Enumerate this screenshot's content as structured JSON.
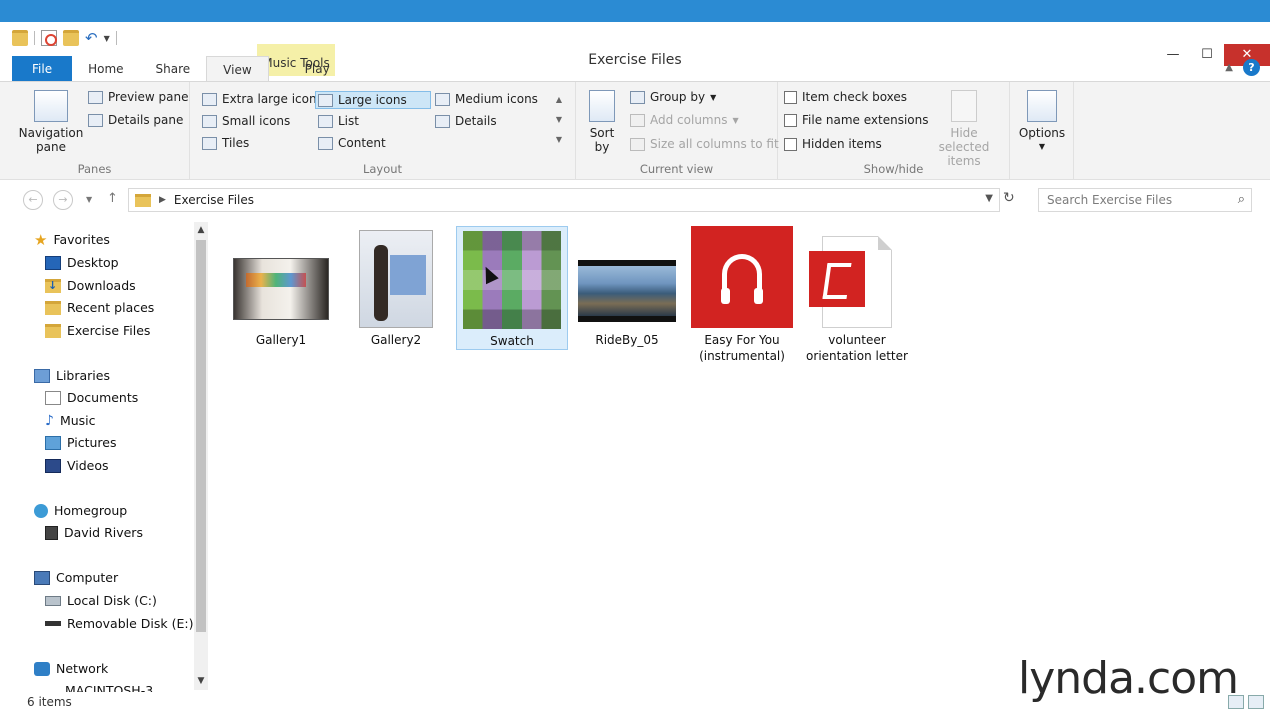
{
  "window": {
    "title": "Exercise Files",
    "contextual_tab": "Music Tools"
  },
  "ribbon_tabs": [
    "File",
    "Home",
    "Share",
    "View",
    "Play"
  ],
  "panes_group": {
    "label": "Panes",
    "navigation_pane": "Navigation",
    "navigation_pane_2": "pane",
    "preview_pane": "Preview pane",
    "details_pane": "Details pane"
  },
  "layout_group": {
    "label": "Layout",
    "options": [
      "Extra large icons",
      "Large icons",
      "Medium icons",
      "Small icons",
      "List",
      "Details",
      "Tiles",
      "Content"
    ],
    "selected": "Large icons"
  },
  "current_view_group": {
    "label": "Current view",
    "sort_by": "Sort",
    "sort_by_2": "by",
    "group_by": "Group by",
    "add_columns": "Add columns",
    "size_columns": "Size all columns to fit"
  },
  "showhide_group": {
    "label": "Show/hide",
    "item_check_boxes": "Item check boxes",
    "file_name_extensions": "File name extensions",
    "hidden_items": "Hidden items",
    "hide_selected": "Hide selected",
    "hide_selected_2": "items"
  },
  "options": "Options",
  "address": {
    "path": "Exercise Files",
    "search_placeholder": "Search Exercise Files"
  },
  "navpane": {
    "favorites": "Favorites",
    "desktop": "Desktop",
    "downloads": "Downloads",
    "recent": "Recent places",
    "exercise": "Exercise Files",
    "libraries": "Libraries",
    "documents": "Documents",
    "music": "Music",
    "pictures": "Pictures",
    "videos": "Videos",
    "homegroup": "Homegroup",
    "user": "David Rivers",
    "computer": "Computer",
    "local_disk": "Local Disk (C:)",
    "removable": "Removable Disk (E:)",
    "network": "Network",
    "cutoff": "MACINTOSH-3"
  },
  "files": [
    {
      "name": "Gallery1",
      "type": "image"
    },
    {
      "name": "Gallery2",
      "type": "image"
    },
    {
      "name": "Swatch",
      "type": "image",
      "selected": true
    },
    {
      "name": "RideBy_05",
      "type": "video"
    },
    {
      "name": "Easy For You",
      "name_2": "(instrumental)",
      "type": "music"
    },
    {
      "name": "volunteer",
      "name_2": "orientation letter",
      "type": "pdf"
    }
  ],
  "status": "6 items",
  "watermark": "lynda.com"
}
